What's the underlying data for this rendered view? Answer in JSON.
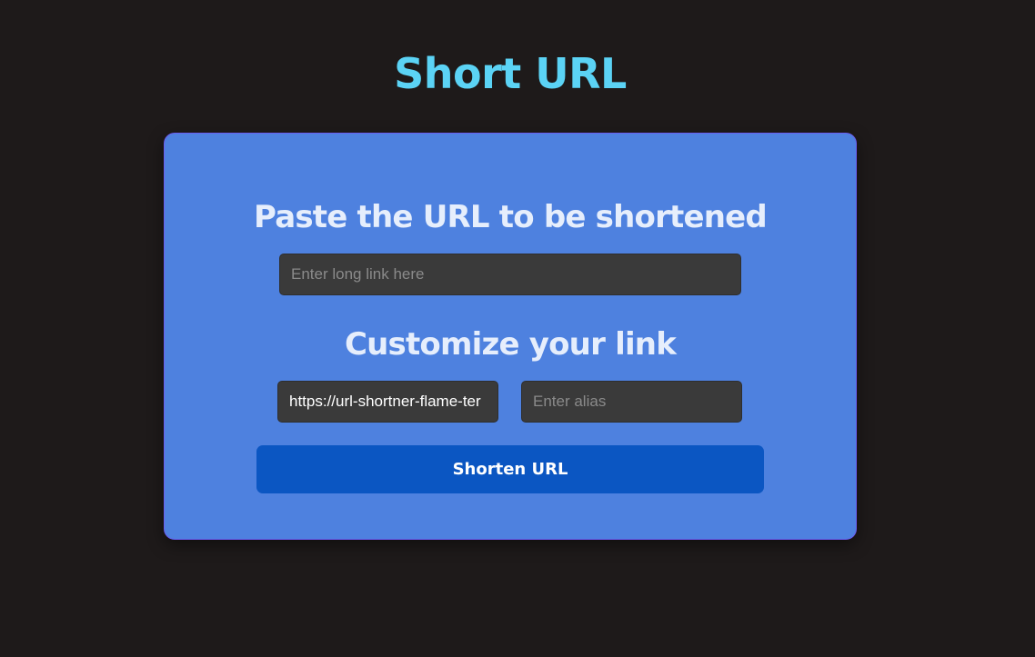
{
  "app": {
    "title": "Short URL"
  },
  "form": {
    "url_heading": "Paste the URL to be shortened",
    "long_url": {
      "value": "",
      "placeholder": "Enter long link here"
    },
    "customize_heading": "Customize your link",
    "base_url": {
      "value": "https://url-shortner-flame-ter"
    },
    "alias": {
      "value": "",
      "placeholder": "Enter alias"
    },
    "submit_label": "Shorten URL"
  },
  "colors": {
    "background": "#1e1a1a",
    "title": "#5bd3f5",
    "card": "#4e81df",
    "input": "#3a3a3a",
    "button": "#0b56c2"
  }
}
